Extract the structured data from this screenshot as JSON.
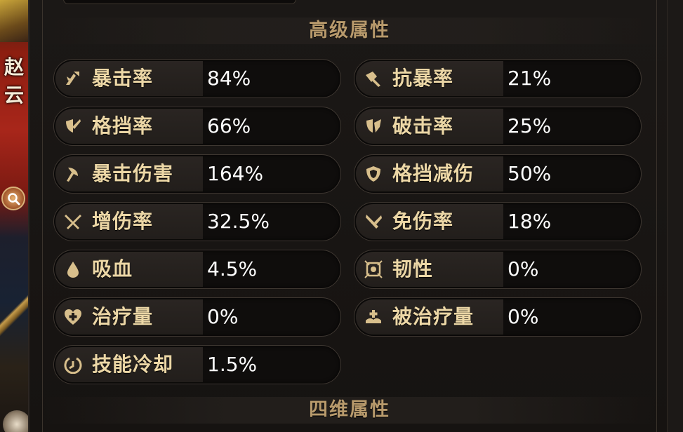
{
  "hero": {
    "name": "赵云"
  },
  "sections": {
    "advanced_title": "高级属性",
    "four_dim_title": "四维属性"
  },
  "stats_left": [
    {
      "label": "暴击率",
      "value": "84%",
      "icon": "crit-sword-icon"
    },
    {
      "label": "格挡率",
      "value": "66%",
      "icon": "block-shield-icon"
    },
    {
      "label": "暴击伤害",
      "value": "164%",
      "icon": "axe-icon"
    },
    {
      "label": "增伤率",
      "value": "32.5%",
      "icon": "crossed-swords-icon"
    },
    {
      "label": "吸血",
      "value": "4.5%",
      "icon": "blood-drop-icon"
    },
    {
      "label": "治疗量",
      "value": "0%",
      "icon": "heal-heart-icon"
    },
    {
      "label": "技能冷却",
      "value": "1.5%",
      "icon": "cooldown-icon"
    }
  ],
  "stats_right": [
    {
      "label": "抗暴率",
      "value": "21%",
      "icon": "anti-crit-icon"
    },
    {
      "label": "破击率",
      "value": "25%",
      "icon": "break-shield-icon"
    },
    {
      "label": "格挡减伤",
      "value": "50%",
      "icon": "shield-reduction-icon"
    },
    {
      "label": "免伤率",
      "value": "18%",
      "icon": "dmg-immune-icon"
    },
    {
      "label": "韧性",
      "value": "0%",
      "icon": "tenacity-icon"
    },
    {
      "label": "被治疗量",
      "value": "0%",
      "icon": "received-heal-icon"
    }
  ],
  "colors": {
    "label": "#ecd7a6",
    "value": "#ffffff",
    "title": "#b89a6c",
    "icon": "#d8bf8c"
  }
}
